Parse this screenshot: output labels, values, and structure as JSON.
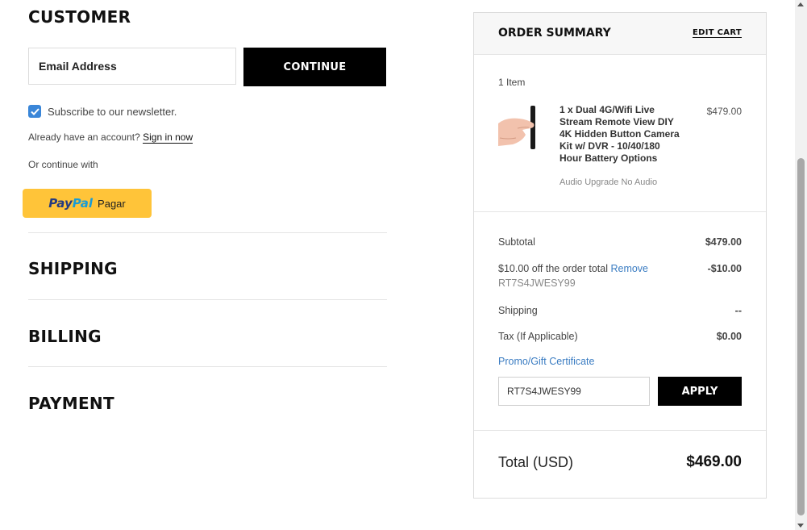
{
  "checkout": {
    "customer": {
      "heading": "CUSTOMER",
      "email_label": "Email Address",
      "continue_label": "CONTINUE",
      "newsletter_label": "Subscribe to our newsletter.",
      "newsletter_checked": true,
      "account_prompt": "Already have an account?",
      "sign_in_label": "Sign in now",
      "continue_with": "Or continue with",
      "paypal": {
        "pay": "Pay",
        "pal": "Pal",
        "pagar": "Pagar"
      }
    },
    "steps": {
      "shipping": "SHIPPING",
      "billing": "BILLING",
      "payment": "PAYMENT"
    }
  },
  "summary": {
    "title": "ORDER SUMMARY",
    "edit_cart": "EDIT CART",
    "item_count": "1 Item",
    "product": {
      "name": "1 x Dual 4G/Wifi Live Stream Remote View DIY 4K Hidden Button Camera Kit w/ DVR - 10/40/180 Hour Battery Options",
      "price": "$479.00",
      "option": "Audio Upgrade No Audio"
    },
    "subtotal_label": "Subtotal",
    "subtotal_value": "$479.00",
    "discount_label": "$10.00 off the order total",
    "remove_label": "Remove",
    "discount_value": "-$10.00",
    "coupon_code": "RT7S4JWESY99",
    "shipping_label": "Shipping",
    "shipping_value": "--",
    "tax_label": "Tax (If Applicable)",
    "tax_value": "$0.00",
    "promo_label": "Promo/Gift Certificate",
    "promo_value": "RT7S4JWESY99",
    "apply_label": "APPLY",
    "total_label": "Total (USD)",
    "total_value": "$469.00"
  },
  "colors": {
    "accent_link": "#3a7cc2",
    "checkbox": "#3a86d8",
    "paypal_yellow": "#ffc439",
    "button_black": "#000000"
  }
}
